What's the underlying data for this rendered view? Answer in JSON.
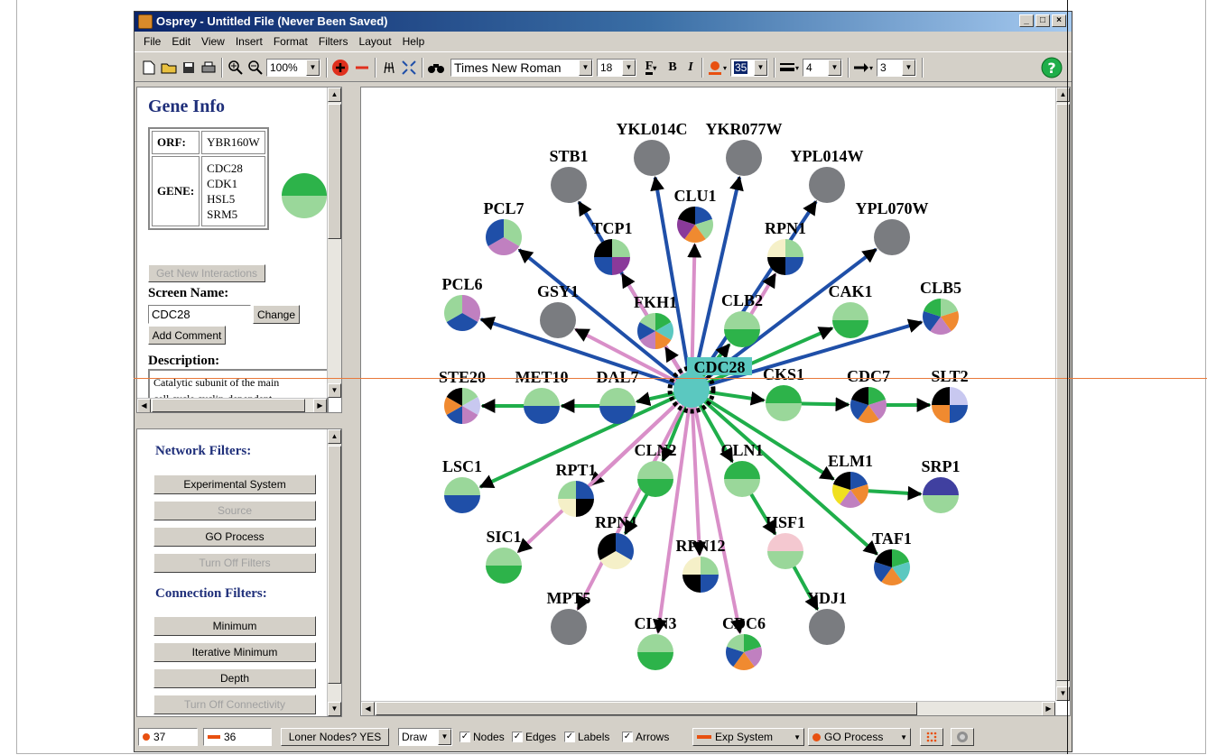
{
  "window": {
    "title": "Osprey - Untitled File (Never Been Saved)",
    "buttons": [
      "_",
      "□",
      "×"
    ]
  },
  "menu": [
    "File",
    "Edit",
    "View",
    "Insert",
    "Format",
    "Filters",
    "Layout",
    "Help"
  ],
  "toolbar": {
    "zoom": "100%",
    "font": "Times New Roman",
    "font_size": "18",
    "bold": "B",
    "italic": "I",
    "node_size": "35",
    "line_width": "4",
    "arrow_size": "3",
    "icons": [
      "new-file-icon",
      "open-folder-icon",
      "save-icon",
      "print-icon",
      "zoom-in-icon",
      "zoom-out-icon",
      "add-node-icon",
      "remove-node-icon",
      "crosshair-icon",
      "fit-icon",
      "binoculars-icon",
      "font-color-icon",
      "node-color-icon",
      "line-width-icon",
      "arrow-size-icon",
      "help-icon"
    ]
  },
  "gene_info": {
    "title": "Gene Info",
    "orf_label": "ORF:",
    "orf_value": "YBR160W",
    "gene_label": "GENE:",
    "gene_values": [
      "CDC28",
      "CDK1",
      "HSL5",
      "SRM5"
    ],
    "get_new_interactions": "Get New Interactions",
    "screen_name_label": "Screen Name:",
    "screen_name_value": "CDC28",
    "change_button": "Change",
    "add_comment_button": "Add Comment",
    "description_label": "Description:",
    "description_lines": [
      "Catalytic subunit of the main",
      "cell cycle cyclin-dependent"
    ]
  },
  "filters": {
    "network_title": "Network Filters:",
    "experimental_system": "Experimental System",
    "source": "Source",
    "go_process": "GO Process",
    "turn_off_filters": "Turn Off Filters",
    "connection_title": "Connection Filters:",
    "minimum": "Minimum",
    "iterative_minimum": "Iterative Minimum",
    "depth": "Depth",
    "turn_off_connectivity": "Turn Off Connectivity"
  },
  "status": {
    "node_count": "37",
    "edge_count": "36",
    "loner_nodes": "Loner Nodes? YES",
    "mode": "Draw",
    "nodes_label": "Nodes",
    "edges_label": "Edges",
    "labels_label": "Labels",
    "arrows_label": "Arrows",
    "color_edges_by": "Exp System",
    "color_nodes_by": "GO Process"
  },
  "colors": {
    "green_edge": "#1fae4a",
    "pink_edge": "#d98fc8",
    "blue_edge": "#1f4fa8",
    "hub": "#5bc8c0",
    "gray_node": "#7a7c80"
  },
  "network": {
    "hub": "CDC28",
    "nodes": [
      {
        "id": "YKL014C",
        "label": "YKL014C"
      },
      {
        "id": "YKR077W",
        "label": "YKR077W"
      },
      {
        "id": "STB1",
        "label": "STB1"
      },
      {
        "id": "YPL014W",
        "label": "YPL014W"
      },
      {
        "id": "CLU1",
        "label": "CLU1"
      },
      {
        "id": "PCL7",
        "label": "PCL7"
      },
      {
        "id": "TCP1",
        "label": "TCP1"
      },
      {
        "id": "RPN1",
        "label": "RPN1"
      },
      {
        "id": "YPL070W",
        "label": "YPL070W"
      },
      {
        "id": "PCL6",
        "label": "PCL6"
      },
      {
        "id": "GSY1",
        "label": "GSY1"
      },
      {
        "id": "FKH1",
        "label": "FKH1"
      },
      {
        "id": "CLB2",
        "label": "CLB2"
      },
      {
        "id": "CAK1",
        "label": "CAK1"
      },
      {
        "id": "CLB5",
        "label": "CLB5"
      },
      {
        "id": "STE20",
        "label": "STE20"
      },
      {
        "id": "MET10",
        "label": "MET10"
      },
      {
        "id": "DAL7",
        "label": "DAL7"
      },
      {
        "id": "CKS1",
        "label": "CKS1"
      },
      {
        "id": "CDC7",
        "label": "CDC7"
      },
      {
        "id": "SLT2",
        "label": "SLT2"
      },
      {
        "id": "LSC1",
        "label": "LSC1"
      },
      {
        "id": "RPT1",
        "label": "RPT1"
      },
      {
        "id": "CLN2",
        "label": "CLN2"
      },
      {
        "id": "CLN1",
        "label": "CLN1"
      },
      {
        "id": "ELM1",
        "label": "ELM1"
      },
      {
        "id": "SRP1",
        "label": "SRP1"
      },
      {
        "id": "SIC1",
        "label": "SIC1"
      },
      {
        "id": "RPN4",
        "label": "RPN4"
      },
      {
        "id": "RPN12",
        "label": "RPN12"
      },
      {
        "id": "HSF1",
        "label": "HSF1"
      },
      {
        "id": "TAF1",
        "label": "TAF1"
      },
      {
        "id": "MPT5",
        "label": "MPT5"
      },
      {
        "id": "YDJ1",
        "label": "YDJ1"
      },
      {
        "id": "CLN3",
        "label": "CLN3"
      },
      {
        "id": "CDC6",
        "label": "CDC6"
      }
    ]
  }
}
